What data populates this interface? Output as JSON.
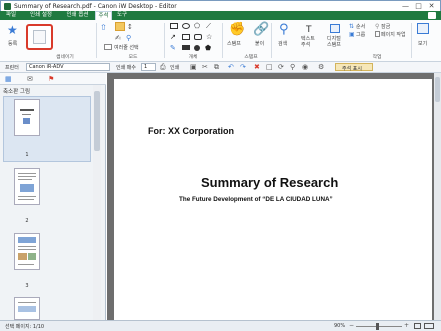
{
  "window": {
    "title": "Summary of Research.pdf - Canon iW Desktop - Editor"
  },
  "menu": {
    "tabs": [
      "파일",
      "인쇄 설정",
      "인쇄 옵션",
      "주석",
      "도구"
    ],
    "active_index": 3
  },
  "ribbon": {
    "stamp_label": "등록",
    "group_thumb": "썸네이기",
    "group_mode": "모드",
    "group_shape": "개체",
    "group_stamp": "스탬프",
    "group_work": "작업",
    "mode_button": "여러줄 선택",
    "stamp_btn": "스탬프",
    "search_btn": "검색",
    "text_btn": "텍스트\n주석",
    "di_btn": "디지털\n스탬프",
    "right_items": [
      "순서",
      "그룹",
      "잠금",
      "페이지 작업"
    ],
    "view_btn": "보기"
  },
  "toolbar": {
    "printer_label": "프린터",
    "printer_value": "Canon iR-ADV",
    "copies_label": "인쇄 매수",
    "copies_value": "1",
    "print_label": "인쇄",
    "annot_label": "주석 표시"
  },
  "leftpane": {
    "title": "축소판 그림",
    "pages": [
      "1",
      "2",
      "3"
    ]
  },
  "document": {
    "for_line": "For: XX Corporation",
    "heading": "Summary of Research",
    "subheading": "The Future Development of “DE LA CIUDAD LUNA”"
  },
  "status": {
    "left": "선택 페이지: 1/10",
    "zoom": "90%"
  },
  "colors": {
    "accent": "#1f7a40",
    "highlight": "#d93a2b"
  }
}
